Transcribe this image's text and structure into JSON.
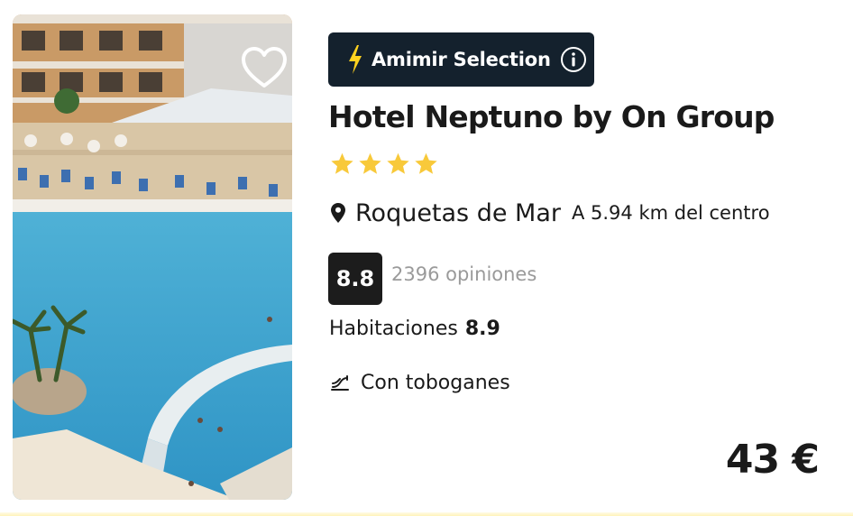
{
  "hotel": {
    "badge": {
      "label": "Amimir Selection",
      "icon": "lightning-bolt-icon",
      "info_icon": "info-icon",
      "bg_color": "#14212d",
      "bolt_color": "#ffd21f"
    },
    "favorite_icon": "heart-outline-icon",
    "name": "Hotel Neptuno by On Group",
    "stars": 4,
    "star_color": "#f8c93a",
    "location": {
      "icon": "map-pin-icon",
      "city": "Roquetas de Mar",
      "distance": "A 5.94 km del centro"
    },
    "rating": {
      "score": "8.8",
      "reviews": "2396 opiniones"
    },
    "rooms": {
      "label": "Habitaciones",
      "score": "8.9"
    },
    "amenity": {
      "icon": "water-slide-icon",
      "label": "Con toboganes"
    },
    "price": "43 €"
  }
}
